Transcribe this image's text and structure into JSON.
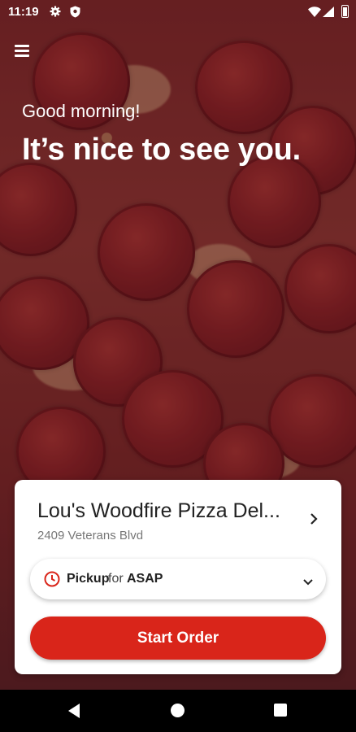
{
  "status_bar": {
    "time": "11:19"
  },
  "header": {
    "greeting": "Good morning!",
    "headline": "It’s nice to see you."
  },
  "store": {
    "name": "Lou's Woodfire Pizza Del...",
    "address": "2409 Veterans Blvd"
  },
  "order_mode": {
    "mode": "Pickup",
    "for_text": "for",
    "time": "ASAP"
  },
  "actions": {
    "start_order": "Start Order"
  },
  "colors": {
    "accent": "#d9251a"
  },
  "icons": [
    "menu-icon",
    "settings-icon",
    "shield-icon",
    "wifi-icon",
    "signal-icon",
    "battery-icon",
    "chevron-right-icon",
    "clock-icon",
    "chevron-down-icon",
    "back-icon",
    "home-icon",
    "recents-icon"
  ]
}
